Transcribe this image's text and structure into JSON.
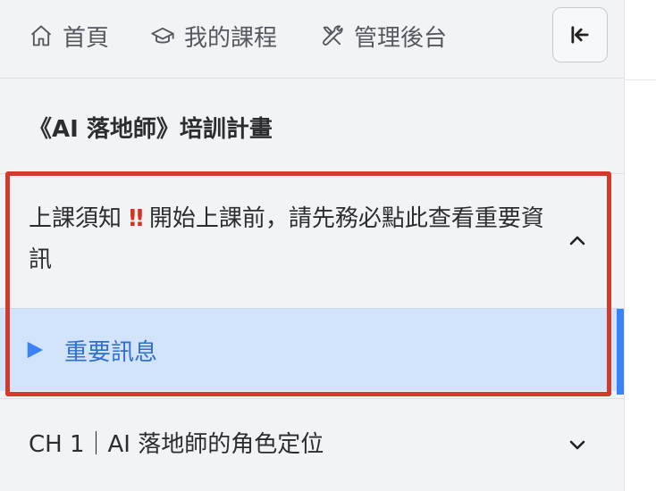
{
  "nav": {
    "home_label": "首頁",
    "courses_label": "我的課程",
    "admin_label": "管理後台"
  },
  "course": {
    "title": "《AI 落地師》培訓計畫"
  },
  "chapters": [
    {
      "prefix": "上課須知 ",
      "alert": "‼",
      "suffix": " 開始上課前，請先務必點此查看重要資訊",
      "expanded": true,
      "lessons": [
        {
          "label": "重要訊息",
          "active": true
        }
      ]
    },
    {
      "title": "CH 1｜AI 落地師的角色定位",
      "expanded": false
    }
  ],
  "colors": {
    "accent": "#3b82f6",
    "active_bg": "#d2e3fc",
    "active_text": "#2f6fcf",
    "highlight": "#d23b2b",
    "alert": "#d93025"
  }
}
